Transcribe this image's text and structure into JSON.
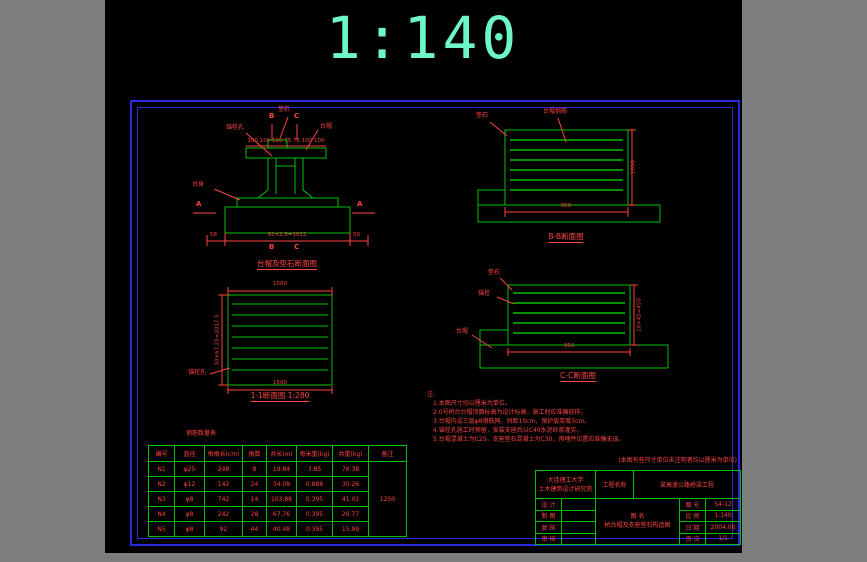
{
  "banner": {
    "scale": "1:140"
  },
  "colors": {
    "line_green": "#00c000",
    "dim_red": "#ff4343",
    "banner_cyan": "#6ef7c6",
    "frame_blue": "#2a2ae0"
  },
  "sec_a": {
    "caption": "台帽及垫石断面图",
    "dim_top": "100 100 100 75 75 100 100",
    "dim_bottom": "92×2.5=1012",
    "dim_left": "58",
    "dim_right": "50",
    "lbl_anchor": "锚栓孔",
    "lbl_stone": "垫石",
    "lbl_cap": "台帽",
    "lbl_body": "台身",
    "mk_a": "A",
    "mk_b": "B",
    "mk_c": "C"
  },
  "sec_bb": {
    "caption": "B-B断面图",
    "dim_right": "1050",
    "dim_bottom": "950",
    "lbl_stone": "垫石",
    "lbl_rebar": "台帽钢筋"
  },
  "sec_11": {
    "caption": "1-1断面图 1:280",
    "dim_top": "1500",
    "dim_bottom": "1500",
    "dim_left": "30×67.25=2017.5",
    "lbl_anchor": "锚栓孔"
  },
  "sec_cc": {
    "caption": "C-C断面图",
    "dim_right": "10×45=450",
    "dim_bottom": "950",
    "lbl_stone": "垫石",
    "lbl_anchor": "锚栓",
    "lbl_cap": "台帽"
  },
  "notes": {
    "title": "注:",
    "lines": [
      "1.本图尺寸均以厘米为单位。",
      "2.0号桥台台帽顶面标高为设计标高，施工时应准确放样。",
      "3.台帽内设三层φ8钢筋网，间距10cm，保护层厚度3cm。",
      "4.锚栓孔施工时预留，安装支座后以C40水泥砂浆灌实。",
      "5.台帽混凝土为C25，支座垫石混凝土为C30，预埋件位置应准确无误。"
    ]
  },
  "rebar_table": {
    "title": "钢筋数量表",
    "headers": [
      "编号",
      "直径",
      "每根长(cm)",
      "根数",
      "共长(m)",
      "每米重(kg)",
      "共重(kg)",
      "备注"
    ],
    "rows": [
      [
        "N1",
        "φ25",
        "248",
        "8",
        "19.84",
        "3.85",
        "76.38"
      ],
      [
        "N2",
        "φ12",
        "142",
        "24",
        "34.08",
        "0.888",
        "30.26"
      ],
      [
        "N3",
        "φ8",
        "742",
        "14",
        "103.88",
        "0.395",
        "41.03"
      ],
      [
        "N4",
        "φ8",
        "242",
        "28",
        "67.76",
        "0.395",
        "26.77"
      ],
      [
        "N5",
        "φ8",
        "92",
        "44",
        "40.48",
        "0.395",
        "15.99"
      ]
    ],
    "remark": "1250"
  },
  "title_block": {
    "note": "(本图有些尺寸单位未注明者均以厘米为单位)",
    "org1": "大连理工大学",
    "org2": "土木建筑设计研究院",
    "project_label": "工程名称",
    "project_value": "某高速公路桥梁工程",
    "r_design": "设 计",
    "r_draft": "制 图",
    "r_check": "复 核",
    "r_audit": "审 核",
    "name_label": "图 名",
    "drawing_name": "桥台帽及支座垫石构造图",
    "f1_label": "图 号",
    "f1_value": "S4-12",
    "f2_label": "比 例",
    "f2_value": "1:140",
    "f3_label": "日 期",
    "f3_value": "2004.06",
    "f4_label": "页 次",
    "f4_value": "1/1"
  }
}
